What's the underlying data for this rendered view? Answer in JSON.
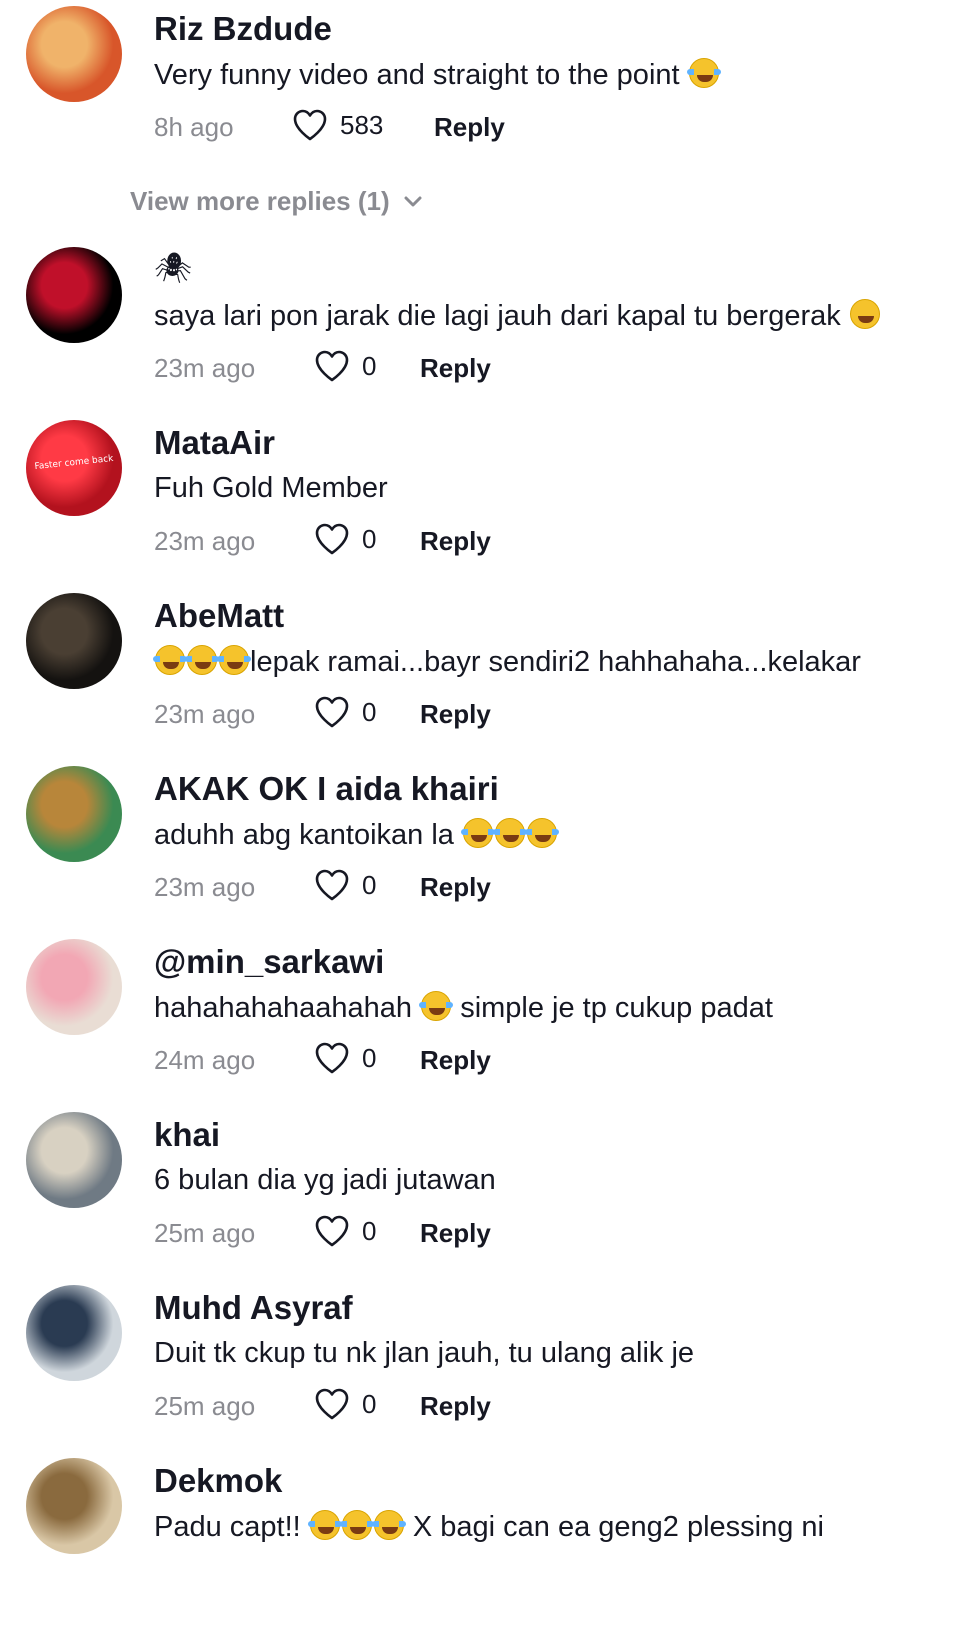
{
  "view_more": {
    "label": "View more replies (1)",
    "icon": "chevron-down-icon"
  },
  "reply_label": "Reply",
  "comments": [
    {
      "username": "Riz Bzdude",
      "text": "Very funny video and straight to the point",
      "emoji_after": 1,
      "time": "8h ago",
      "likes": "583",
      "avatar": {
        "bg": "#d8562a",
        "accent": "#f0b36a"
      }
    },
    {
      "username": "",
      "username_icon": "spider-icon",
      "text": "saya lari pon jarak die lagi jauh dari kapal tu bergerak",
      "emoji_after": 1,
      "time": "23m ago",
      "likes": "0",
      "avatar": {
        "bg": "#000000",
        "accent": "#c0102a"
      }
    },
    {
      "username": "MataAir",
      "text": "Fuh Gold Member",
      "emoji_after": 0,
      "time": "23m ago",
      "likes": "0",
      "avatar": {
        "bg": "#b3121e",
        "accent": "#ff3a45",
        "caption": "Faster come back"
      }
    },
    {
      "username": "AbeMatt",
      "text": "lepak ramai...bayr sendiri2 hahhahaha...kelakar",
      "emoji_before": 3,
      "time": "23m ago",
      "likes": "0",
      "avatar": {
        "bg": "#141210",
        "accent": "#4a3f33"
      }
    },
    {
      "username": "AKAK OK I aida khairi",
      "text": "aduhh abg kantoikan la",
      "emoji_after": 3,
      "time": "23m ago",
      "likes": "0",
      "avatar": {
        "bg": "#3b8a52",
        "accent": "#b8863a"
      }
    },
    {
      "username": "@min_sarkawi",
      "text": "hahahahahaahahah",
      "text2": "simple je tp cukup padat",
      "emoji_mid": 1,
      "time": "24m ago",
      "likes": "0",
      "avatar": {
        "bg": "#e9ddd4",
        "accent": "#f2a7b4"
      }
    },
    {
      "username": "khai",
      "text": "6 bulan dia yg jadi jutawan",
      "emoji_after": 0,
      "time": "25m ago",
      "likes": "0",
      "avatar": {
        "bg": "#6f7a84",
        "accent": "#d8d1c2"
      }
    },
    {
      "username": "Muhd Asyraf",
      "text": "Duit tk ckup tu nk jlan jauh, tu ulang alik je",
      "emoji_after": 0,
      "time": "25m ago",
      "likes": "0",
      "avatar": {
        "bg": "#cfd6dc",
        "accent": "#2a3b52"
      }
    },
    {
      "username": "Dekmok",
      "text": "Padu capt!!",
      "text2": "X bagi can ea geng2 plessing ni",
      "emoji_mid": 3,
      "time": "",
      "likes": "",
      "avatar": {
        "bg": "#d9c7a6",
        "accent": "#8a6a3e"
      }
    }
  ]
}
